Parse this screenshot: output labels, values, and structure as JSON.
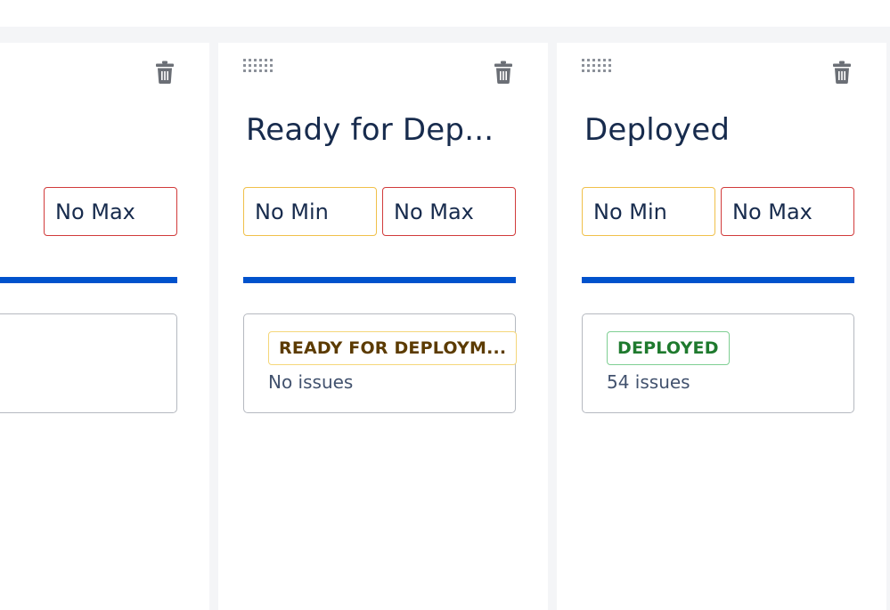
{
  "columns": [
    {
      "title": "",
      "min_value": "",
      "max_value": "No Max",
      "status": {
        "label": "",
        "issues": ""
      }
    },
    {
      "title": "Ready for Dep...",
      "min_value": "No Min",
      "max_value": "No Max",
      "status": {
        "label": "READY FOR DEPLOYM...",
        "issues": "No issues",
        "color": "#f5d77a"
      }
    },
    {
      "title": "Deployed",
      "min_value": "No Min",
      "max_value": "No Max",
      "status": {
        "label": "DEPLOYED",
        "issues": "54 issues",
        "color": "#1f7a2e"
      }
    }
  ],
  "icons": {
    "drag": "drag-handle-icon",
    "delete": "trash-icon"
  },
  "colors": {
    "progress": "#0052cc",
    "min_border": "#f0c04a",
    "max_border": "#d13b3b",
    "title": "#172b4d"
  }
}
